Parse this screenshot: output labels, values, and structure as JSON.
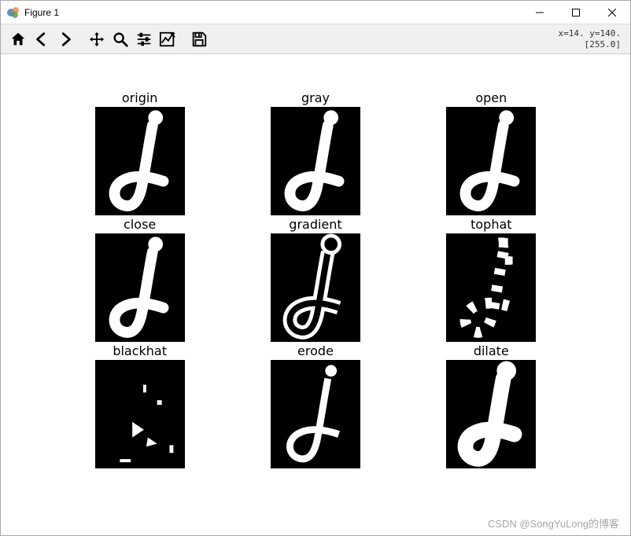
{
  "window": {
    "title": "Figure 1"
  },
  "toolbar": {
    "coord_line1": "x=14. y=140.",
    "coord_line2": "[255.0]"
  },
  "subplots": [
    {
      "title": "origin",
      "variant": "normal"
    },
    {
      "title": "gray",
      "variant": "normal"
    },
    {
      "title": "open",
      "variant": "normal"
    },
    {
      "title": "close",
      "variant": "normal"
    },
    {
      "title": "gradient",
      "variant": "outline"
    },
    {
      "title": "tophat",
      "variant": "tophat"
    },
    {
      "title": "blackhat",
      "variant": "blackhat"
    },
    {
      "title": "erode",
      "variant": "thin"
    },
    {
      "title": "dilate",
      "variant": "thick"
    }
  ],
  "watermark": "CSDN @SongYuLong的博客"
}
